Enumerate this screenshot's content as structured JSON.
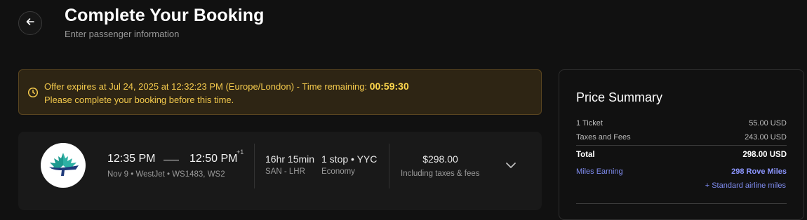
{
  "header": {
    "back_icon": "arrow-left-icon",
    "title": "Complete Your Booking",
    "subtitle": "Enter passenger information"
  },
  "offer": {
    "icon": "clock-icon",
    "message": "Offer expires at Jul 24, 2025 at 12:32:23 PM (Europe/London) - Time remaining: ",
    "timer": "00:59:30",
    "note": "Please complete your booking before this time.",
    "color_text": "#f3c94c",
    "color_bg": "#2e2514"
  },
  "flight": {
    "airline_logo": "westjet-maple-leaf-logo",
    "departure_time": "12:35 PM",
    "arrival_time": "12:50 PM",
    "day_offset": "+1",
    "meta": "Nov 9 • WestJet • WS1483, WS2",
    "duration": "16hr 15min",
    "route": "SAN - LHR",
    "stops": "1 stop • YYC",
    "cabin": "Economy",
    "price": "$298.00",
    "price_note": "Including taxes & fees",
    "expand_icon": "chevron-down-icon"
  },
  "summary": {
    "title": "Price Summary",
    "ticket_label": "1 Ticket",
    "ticket_value": "55.00 USD",
    "taxes_label": "Taxes and Fees",
    "taxes_value": "243.00 USD",
    "total_label": "Total",
    "total_value": "298.00 USD",
    "miles_label": "Miles Earning",
    "miles_value": "298 Rove Miles",
    "standard_miles": "+ Standard airline miles",
    "accent_color": "#7f8cf0"
  }
}
